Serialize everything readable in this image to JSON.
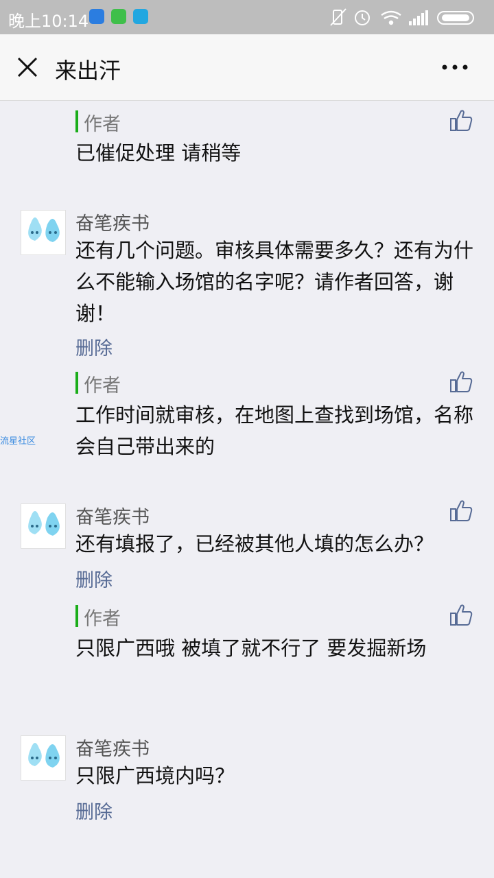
{
  "statusbar": {
    "time": "晚上10:14",
    "icons": [
      "shield-app-icon",
      "game-app-icon",
      "translate-app-icon",
      "vibrate-off-icon",
      "alarm-icon",
      "wifi-icon",
      "signal-icon",
      "battery-icon"
    ]
  },
  "navbar": {
    "title": "来出汗",
    "close_icon": "close-icon",
    "more_icon": "more-icon"
  },
  "comments": [
    {
      "author_reply": {
        "label": "作者",
        "text": "已催促处理 请稍等"
      }
    },
    {
      "user": "奋笔疾书",
      "text": "还有几个问题。审核具体需要多久？还有为什么不能输入场馆的名字呢？请作者回答，谢谢！",
      "delete_label": "删除",
      "author_reply": {
        "label": "作者",
        "text": "工作时间就审核，在地图上查找到场馆，名称会自己带出来的"
      }
    },
    {
      "user": "奋笔疾书",
      "text": "还有填报了，已经被其他人填的怎么办？",
      "delete_label": "删除",
      "author_reply": {
        "label": "作者",
        "text": "只限广西哦  被填了就不行了  要发掘新场"
      }
    },
    {
      "user": "奋笔疾书",
      "text": "只限广西境内吗？",
      "delete_label": "删除"
    }
  ],
  "watermark": "流星社区",
  "colors": {
    "accent_green": "#1aad19",
    "link_blue": "#576b95",
    "background": "#efeff4"
  }
}
